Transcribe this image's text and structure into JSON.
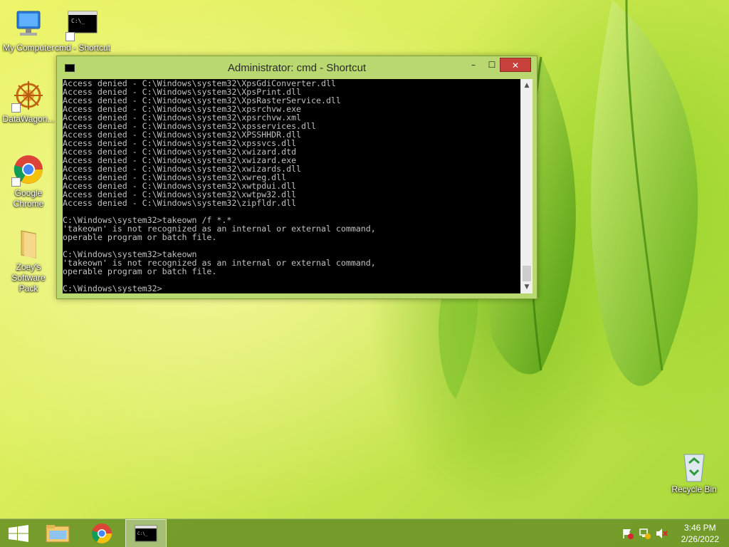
{
  "desktop": {
    "icons": [
      {
        "label": "My Computer"
      },
      {
        "label": "cmd - Shortcut"
      },
      {
        "label": "DataWagon..."
      },
      {
        "label": "Google Chrome"
      },
      {
        "label": "Zoey's Software Pack"
      },
      {
        "label": "Recycle Bin"
      }
    ]
  },
  "window": {
    "title": "Administrator: cmd - Shortcut",
    "controls": {
      "minimize": "–",
      "maximize": "☐",
      "close": "✕"
    },
    "console_lines": [
      "Access denied - C:\\Windows\\system32\\XpsGdiConverter.dll",
      "Access denied - C:\\Windows\\system32\\XpsPrint.dll",
      "Access denied - C:\\Windows\\system32\\XpsRasterService.dll",
      "Access denied - C:\\Windows\\system32\\xpsrchvw.exe",
      "Access denied - C:\\Windows\\system32\\xpsrchvw.xml",
      "Access denied - C:\\Windows\\system32\\xpsservices.dll",
      "Access denied - C:\\Windows\\system32\\XPSSHHDR.dll",
      "Access denied - C:\\Windows\\system32\\xpssvcs.dll",
      "Access denied - C:\\Windows\\system32\\xwizard.dtd",
      "Access denied - C:\\Windows\\system32\\xwizard.exe",
      "Access denied - C:\\Windows\\system32\\xwizards.dll",
      "Access denied - C:\\Windows\\system32\\xwreg.dll",
      "Access denied - C:\\Windows\\system32\\xwtpdui.dll",
      "Access denied - C:\\Windows\\system32\\xwtpw32.dll",
      "Access denied - C:\\Windows\\system32\\zipfldr.dll",
      "",
      "C:\\Windows\\system32>takeown /f *.*",
      "'takeown' is not recognized as an internal or external command,",
      "operable program or batch file.",
      "",
      "C:\\Windows\\system32>takeown",
      "'takeown' is not recognized as an internal or external command,",
      "operable program or batch file.",
      "",
      "C:\\Windows\\system32>"
    ]
  },
  "taskbar": {
    "clock_time": "3:46 PM",
    "clock_date": "2/26/2022"
  },
  "colors": {
    "console_bg": "#000000",
    "console_text": "#c0c0c0",
    "close_button": "#c7403a",
    "taskbar": "#6e9628"
  }
}
